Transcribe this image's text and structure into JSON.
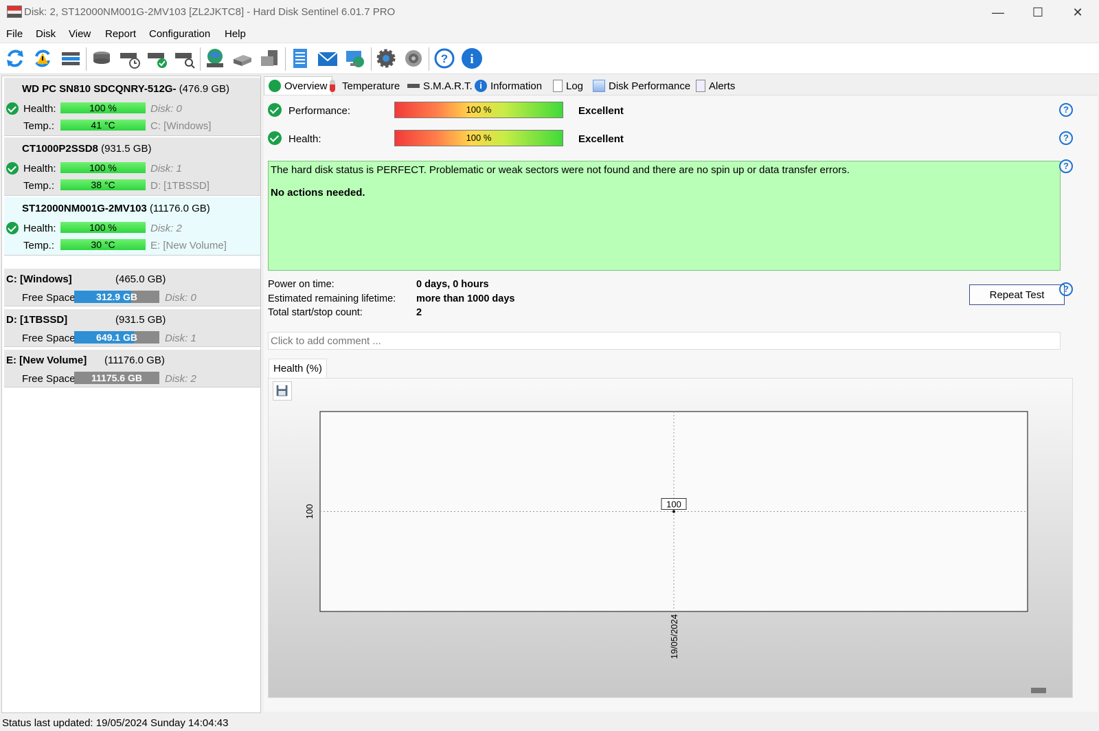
{
  "window": {
    "title": "Disk: 2, ST12000NM001G-2MV103 [ZL2JKTC8]  -  Hard Disk Sentinel 6.01.7 PRO"
  },
  "menu": {
    "items": [
      "File",
      "Disk",
      "View",
      "Report",
      "Configuration",
      "Help"
    ]
  },
  "toolbar": {
    "icons": [
      "refresh-icon",
      "refresh-warning-icon",
      "disk-list-icon",
      "disk-icon",
      "disk-schedule-icon",
      "disk-check-icon",
      "disk-search-icon",
      "network-drive-icon",
      "remote-disk-icon",
      "server-icon",
      "report-icon",
      "email-icon",
      "web-report-icon",
      "settings-icon",
      "sound-icon",
      "help-icon",
      "info-icon"
    ]
  },
  "disks": [
    {
      "name": "WD PC SN810 SDCQNRY-512G-",
      "size": "(476.9 GB)",
      "health_label": "Health:",
      "health": "100 %",
      "temp_label": "Temp.:",
      "temp": "41 °C",
      "disk": "Disk: 0",
      "volume_letter": "C:",
      "volume": "[Windows]"
    },
    {
      "name": "CT1000P2SSD8",
      "size": "(931.5 GB)",
      "health_label": "Health:",
      "health": "100 %",
      "temp_label": "Temp.:",
      "temp": "38 °C",
      "disk": "Disk: 1",
      "volume_letter": "D:",
      "volume": "[1TBSSD]"
    },
    {
      "name": "ST12000NM001G-2MV103",
      "size": "(11176.0 GB)",
      "health_label": "Health:",
      "health": "100 %",
      "temp_label": "Temp.:",
      "temp": "30 °C",
      "disk": "Disk: 2",
      "volume_letter": "E:",
      "volume": "[New Volume]"
    }
  ],
  "volumes": [
    {
      "name": "C: [Windows]",
      "size": "(465.0 GB)",
      "free_label": "Free Space",
      "free": "312.9 GB",
      "free_fraction": 0.67,
      "disk": "Disk: 0",
      "bar_color": "#2e8fd4"
    },
    {
      "name": "D: [1TBSSD]",
      "size": "(931.5 GB)",
      "free_label": "Free Space",
      "free": "649.1 GB",
      "free_fraction": 0.7,
      "disk": "Disk: 1",
      "bar_color": "#2e8fd4"
    },
    {
      "name": "E: [New Volume]",
      "size": "(11176.0 GB)",
      "free_label": "Free Space",
      "free": "11175.6 GB",
      "free_fraction": 1.0,
      "disk": "Disk: 2",
      "bar_color": "#8a8a8a"
    }
  ],
  "tabs": [
    "Overview",
    "Temperature",
    "S.M.A.R.T.",
    "Information",
    "Log",
    "Disk Performance",
    "Alerts"
  ],
  "overview": {
    "performance_label": "Performance:",
    "performance_value": "100 %",
    "performance_rating": "Excellent",
    "health_label": "Health:",
    "health_value": "100 %",
    "health_rating": "Excellent",
    "status_text": "The hard disk status is PERFECT. Problematic or weak sectors were not found and there are no spin up or data transfer errors.",
    "status_action": "No actions needed.",
    "power_on_label": "Power on time:",
    "power_on_value": "0 days, 0 hours",
    "lifetime_label": "Estimated remaining lifetime:",
    "lifetime_value": "more than 1000 days",
    "startstop_label": "Total start/stop count:",
    "startstop_value": "2",
    "repeat_test_label": "Repeat Test",
    "comment_placeholder": "Click to add comment ..."
  },
  "chart_tab": "Health (%)",
  "chart_data": {
    "type": "line",
    "x": [
      "19/05/2024"
    ],
    "series": [
      {
        "values": [
          100
        ]
      }
    ],
    "data_labels": [
      "100"
    ],
    "ytick_labels": [
      "100"
    ],
    "xtick_labels": [
      "19/05/2024"
    ],
    "grid": true
  },
  "status": {
    "text": "Status last updated: 19/05/2024 Sunday 14:04:43"
  },
  "colors": {
    "health_bar": "#2fd63f",
    "status_box": "#baffb8",
    "accent": "#1f73d3",
    "check": "#1ba04a"
  }
}
